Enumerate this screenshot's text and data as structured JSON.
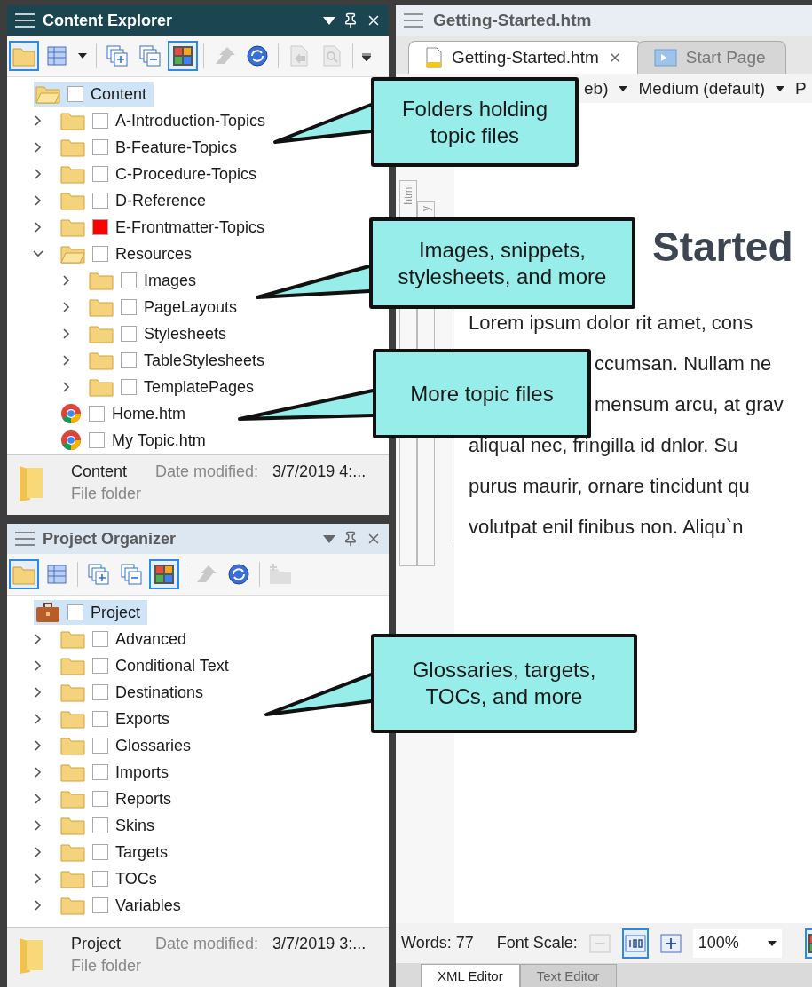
{
  "content_explorer": {
    "title": "Content Explorer",
    "active": true,
    "toolbar": [
      {
        "kind": "folder",
        "selected": true,
        "disabled": false
      },
      {
        "kind": "table",
        "selected": false,
        "disabled": false
      },
      {
        "kind": "caret",
        "selected": false,
        "disabled": false
      },
      {
        "kind": "separator"
      },
      {
        "kind": "add-pages",
        "selected": false,
        "disabled": false
      },
      {
        "kind": "remove-pages",
        "selected": false,
        "disabled": false
      },
      {
        "kind": "color-grid",
        "selected": true,
        "disabled": false
      },
      {
        "kind": "separator"
      },
      {
        "kind": "upload",
        "selected": false,
        "disabled": true
      },
      {
        "kind": "sync",
        "selected": false,
        "disabled": false
      },
      {
        "kind": "separator"
      },
      {
        "kind": "doc-arrow",
        "selected": false,
        "disabled": true
      },
      {
        "kind": "doc-search",
        "selected": false,
        "disabled": true
      },
      {
        "kind": "separator"
      },
      {
        "kind": "overflow",
        "selected": false,
        "disabled": false
      }
    ],
    "tree": [
      {
        "label": "Content",
        "kind": "root-folder",
        "selected": true,
        "children": [
          {
            "label": "A-Introduction-Topics",
            "kind": "folder",
            "expanded": false,
            "selected": false
          },
          {
            "label": "B-Feature-Topics",
            "kind": "folder",
            "expanded": false,
            "selected": false
          },
          {
            "label": "C-Procedure-Topics",
            "kind": "folder",
            "expanded": false,
            "selected": false
          },
          {
            "label": "D-Reference",
            "kind": "folder",
            "expanded": false,
            "selected": false
          },
          {
            "label": "E-Frontmatter-Topics",
            "kind": "folder",
            "expanded": false,
            "selected": false,
            "color": "#ff0000"
          },
          {
            "label": "Resources",
            "kind": "folder",
            "expanded": true,
            "selected": false,
            "children": [
              {
                "label": "Images",
                "kind": "folder",
                "expanded": false,
                "selected": false
              },
              {
                "label": "PageLayouts",
                "kind": "folder",
                "expanded": false,
                "selected": false
              },
              {
                "label": "Stylesheets",
                "kind": "folder",
                "expanded": false,
                "selected": false
              },
              {
                "label": "TableStylesheets",
                "kind": "folder",
                "expanded": false,
                "selected": false
              },
              {
                "label": "TemplatePages",
                "kind": "folder",
                "expanded": false,
                "selected": false
              }
            ]
          },
          {
            "label": "Home.htm",
            "kind": "file",
            "selected": false
          },
          {
            "label": "My Topic.htm",
            "kind": "file",
            "selected": false
          }
        ]
      }
    ],
    "details": {
      "name": "Content",
      "date_label": "Date modified:",
      "date": "3/7/2019 4:...",
      "type": "File folder"
    }
  },
  "project_organizer": {
    "title": "Project Organizer",
    "active": false,
    "toolbar": [
      {
        "kind": "folder",
        "selected": true,
        "disabled": false
      },
      {
        "kind": "table",
        "selected": false,
        "disabled": false
      },
      {
        "kind": "separator"
      },
      {
        "kind": "add-pages",
        "selected": false,
        "disabled": false
      },
      {
        "kind": "remove-pages",
        "selected": false,
        "disabled": false
      },
      {
        "kind": "color-grid",
        "selected": true,
        "disabled": false
      },
      {
        "kind": "separator"
      },
      {
        "kind": "upload",
        "selected": false,
        "disabled": true
      },
      {
        "kind": "sync",
        "selected": false,
        "disabled": false
      },
      {
        "kind": "separator"
      },
      {
        "kind": "new-folder",
        "selected": false,
        "disabled": true
      }
    ],
    "tree": [
      {
        "label": "Project",
        "kind": "project",
        "selected": true,
        "children": [
          {
            "label": "Advanced",
            "kind": "folder",
            "expanded": false,
            "selected": false
          },
          {
            "label": "Conditional Text",
            "kind": "folder",
            "expanded": false,
            "selected": false
          },
          {
            "label": "Destinations",
            "kind": "folder",
            "expanded": false,
            "selected": false
          },
          {
            "label": "Exports",
            "kind": "folder",
            "expanded": false,
            "selected": false
          },
          {
            "label": "Glossaries",
            "kind": "folder",
            "expanded": false,
            "selected": false
          },
          {
            "label": "Imports",
            "kind": "folder",
            "expanded": false,
            "selected": false
          },
          {
            "label": "Reports",
            "kind": "folder",
            "expanded": false,
            "selected": false
          },
          {
            "label": "Skins",
            "kind": "folder",
            "expanded": false,
            "selected": false
          },
          {
            "label": "Targets",
            "kind": "folder",
            "expanded": false,
            "selected": false
          },
          {
            "label": "TOCs",
            "kind": "folder",
            "expanded": false,
            "selected": false
          },
          {
            "label": "Variables",
            "kind": "folder",
            "expanded": false,
            "selected": false
          }
        ]
      }
    ],
    "details": {
      "name": "Project",
      "date_label": "Date modified:",
      "date": "3/7/2019 3:...",
      "type": "File folder"
    }
  },
  "editor": {
    "title": "Getting-Started.htm",
    "tabs": [
      {
        "label": "Getting-Started.htm",
        "selected": true
      },
      {
        "label": "Start Page",
        "selected": false
      }
    ],
    "toolbar": [
      "eb)",
      "Medium (default)",
      "P"
    ],
    "structure_labels": [
      "html",
      "y"
    ],
    "heading": "Started",
    "paragraph_lines": [
      "Lorem ipsum dolor rit amet, cons",
      "ccumsan. Nullam ne",
      "mensum arcu, at grav",
      "aliqual nec, fringilla id dnlor. Su",
      "purus maurir, ornare tincidunt qu",
      "volutpat enil finibus non. Aliqu`n"
    ],
    "status": {
      "words": "Words: 77",
      "font_scale_label": "Font Scale:",
      "zoom": "100%",
      "buttons": [
        {
          "kind": "zoom-out",
          "selected": false,
          "disabled": true
        },
        {
          "kind": "reset-zoom",
          "selected": true,
          "disabled": false
        },
        {
          "kind": "zoom-in",
          "selected": false,
          "disabled": false
        },
        {
          "kind": "color-grid",
          "selected": true,
          "disabled": false
        }
      ]
    },
    "view_tabs": [
      {
        "label": "XML Editor",
        "selected": true
      },
      {
        "label": "Text Editor",
        "selected": false
      }
    ]
  },
  "callouts": [
    {
      "text": "Folders holding\ntopic files"
    },
    {
      "text": "Images, snippets,\nstylesheets, and more"
    },
    {
      "text": "More topic files"
    },
    {
      "text": "Glossaries, targets,\nTOCs, and more"
    }
  ]
}
